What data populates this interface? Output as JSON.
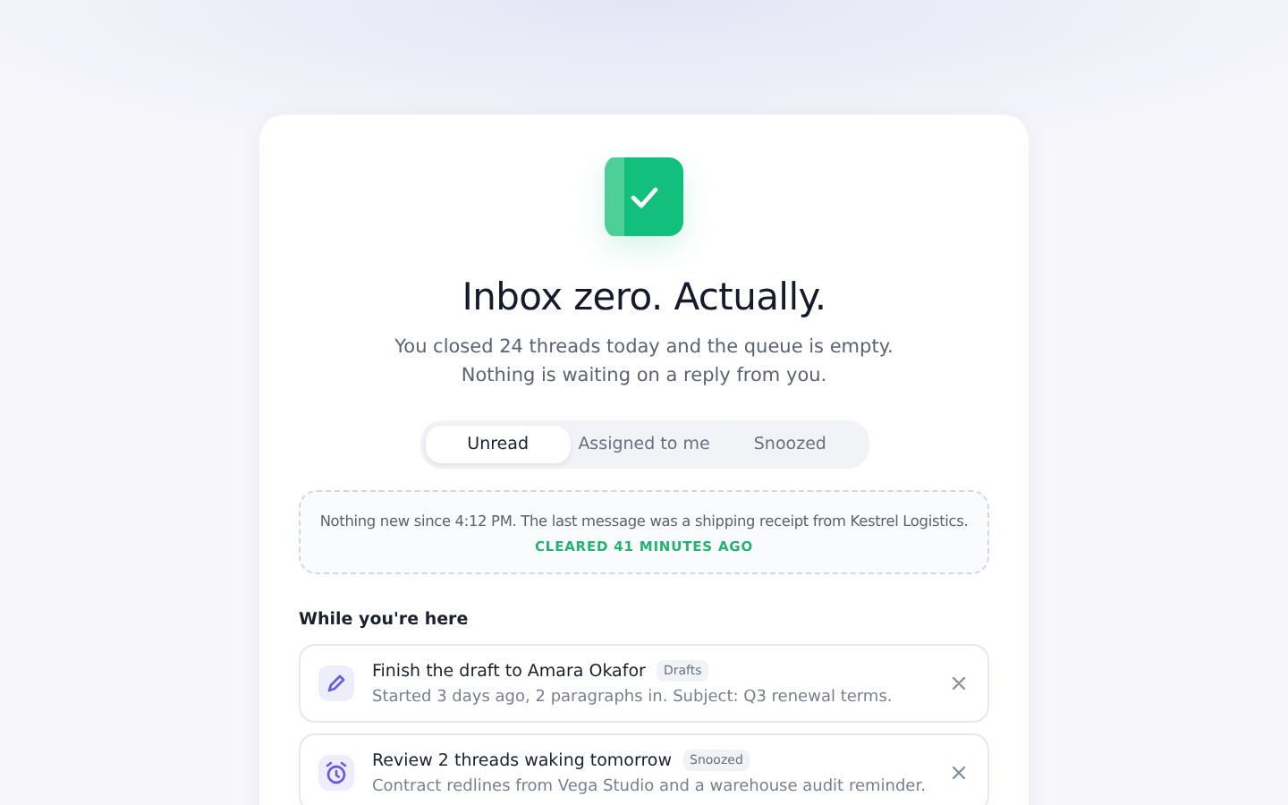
{
  "hero": {
    "title": "Inbox zero. Actually.",
    "subtitle": "You closed 24 threads today and the queue is empty. Nothing is waiting on a reply from you."
  },
  "tabs": [
    {
      "label": "Unread",
      "selected": true
    },
    {
      "label": "Assigned to me",
      "selected": false
    },
    {
      "label": "Snoozed",
      "selected": false
    }
  ],
  "notice": {
    "text": "Nothing new since 4:12 PM. The last message was a shipping receipt from Kestrel Logistics.",
    "status": "CLEARED 41 MINUTES AGO"
  },
  "suggestions": {
    "heading": "While you're here",
    "items": [
      {
        "kind": "draft",
        "title": "Finish the draft to Amara Okafor",
        "tag": "Drafts",
        "detail": "Started 3 days ago, 2 paragraphs in. Subject: Q3 renewal terms."
      },
      {
        "kind": "snoozed",
        "title": "Review 2 threads waking tomorrow",
        "tag": "Snoozed",
        "detail": "Contract redlines from Vega Studio and a warehouse audit reminder."
      }
    ]
  }
}
